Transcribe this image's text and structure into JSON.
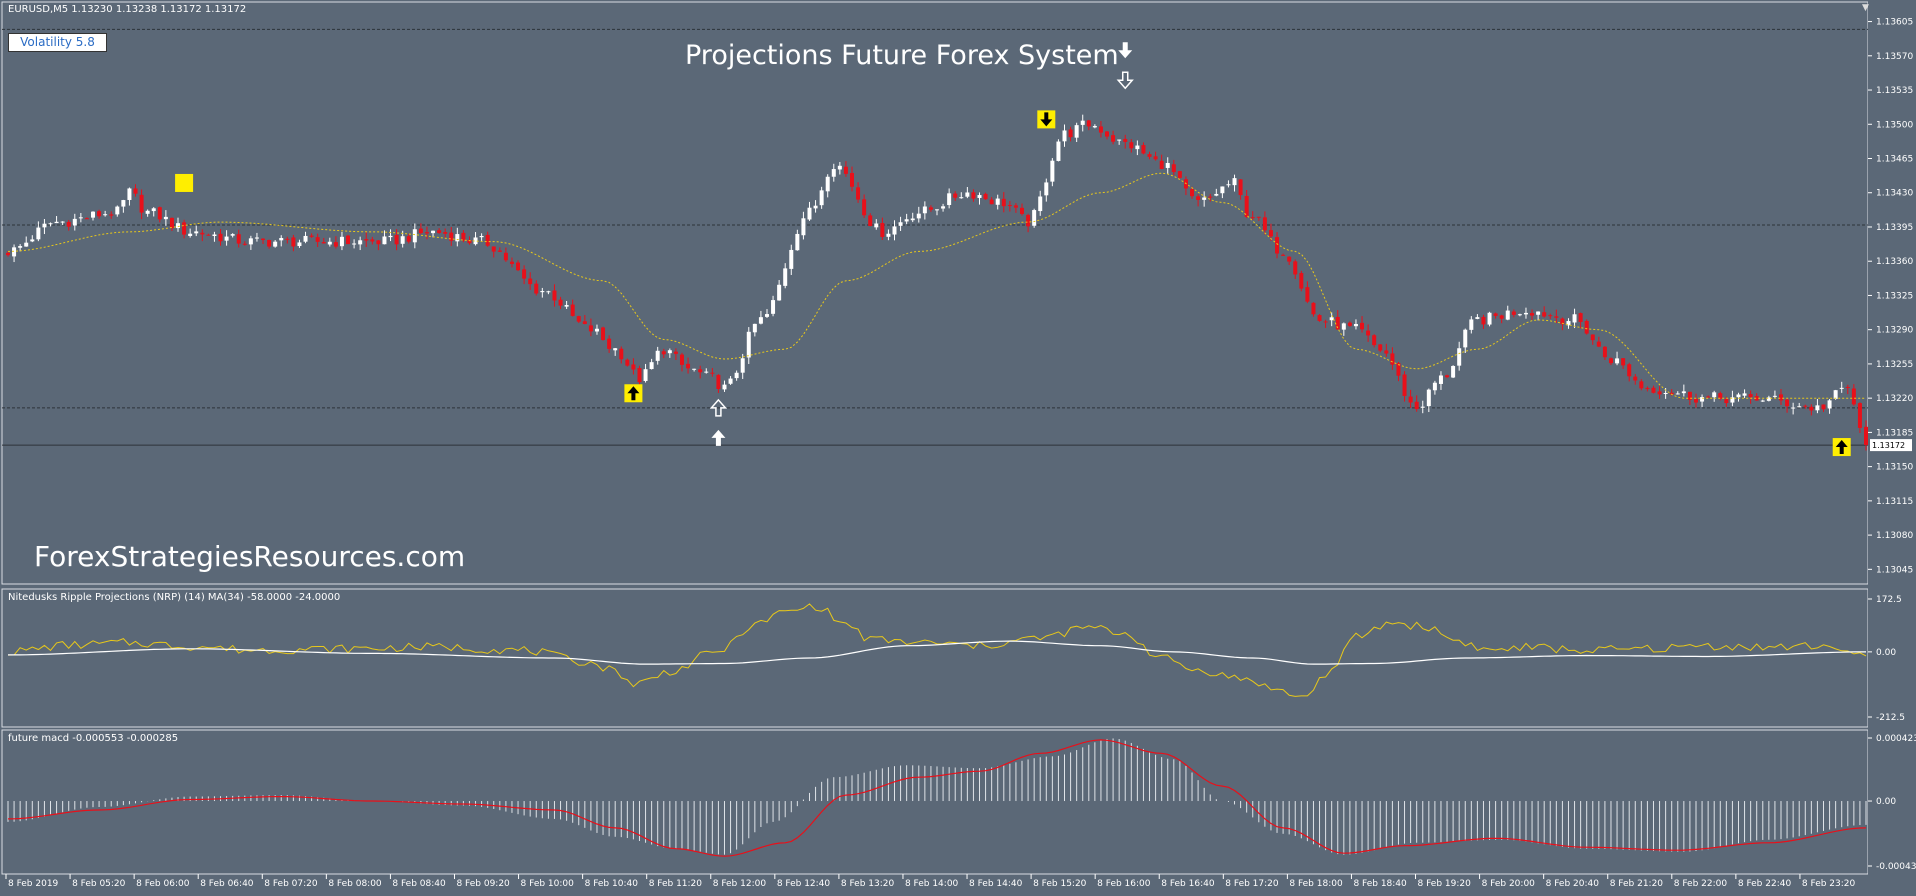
{
  "chart_header": {
    "symbol_line": "EURUSD,M5  1.13230 1.13238 1.13172 1.13172",
    "volatility_label": "Volatility 5.8",
    "title": "Projections Future Forex System",
    "watermark": "ForexStrategiesResources.com"
  },
  "nrp_panel": {
    "label": "Nitedusks Ripple Projections (NRP) (14) MA(34) -58.0000 -24.0000",
    "scale": [
      "172.5",
      "0.00",
      "-212.5"
    ]
  },
  "macd_panel": {
    "label": "future macd -0.000553 -0.000285",
    "scale": [
      "0.000423",
      "0.00",
      "-0.000436"
    ]
  },
  "price_axis": [
    "1.13605",
    "1.13570",
    "1.13535",
    "1.13500",
    "1.13465",
    "1.13430",
    "1.13395",
    "1.13360",
    "1.13325",
    "1.13290",
    "1.13255",
    "1.13220",
    "1.13185",
    "1.13150",
    "1.13115",
    "1.13080",
    "1.13045"
  ],
  "current_price": "1.13172",
  "time_axis": [
    "8 Feb 2019",
    "8 Feb 05:20",
    "8 Feb 06:00",
    "8 Feb 06:40",
    "8 Feb 07:20",
    "8 Feb 08:00",
    "8 Feb 08:40",
    "8 Feb 09:20",
    "8 Feb 10:00",
    "8 Feb 10:40",
    "8 Feb 11:20",
    "8 Feb 12:00",
    "8 Feb 12:40",
    "8 Feb 13:20",
    "8 Feb 14:00",
    "8 Feb 14:40",
    "8 Feb 15:20",
    "8 Feb 16:00",
    "8 Feb 16:40",
    "8 Feb 17:20",
    "8 Feb 18:00",
    "8 Feb 18:40",
    "8 Feb 19:20",
    "8 Feb 20:00",
    "8 Feb 20:40",
    "8 Feb 21:20",
    "8 Feb 22:00",
    "8 Feb 22:40",
    "8 Feb 23:20"
  ],
  "colors": {
    "background": "#5b6877",
    "bull_candle": "#ffffff",
    "bear_candle": "#e8101a",
    "ma_line": "#e8c81a",
    "signal_box": "#ffee00",
    "nrp_fast": "#e8c81a",
    "nrp_slow": "#ffffff",
    "macd_signal": "#e8101a",
    "macd_hist": "#dfe3e8"
  },
  "chart_data": {
    "type": "candlestick",
    "symbol": "EURUSD",
    "timeframe": "M5",
    "ylim": [
      1.1303,
      1.13625
    ],
    "close_anchors": [
      [
        0,
        1.1337
      ],
      [
        8,
        1.134
      ],
      [
        18,
        1.1341
      ],
      [
        20,
        1.1343
      ],
      [
        23,
        1.1341
      ],
      [
        30,
        1.1339
      ],
      [
        40,
        1.1338
      ],
      [
        55,
        1.1338
      ],
      [
        62,
        1.1338
      ],
      [
        70,
        1.1339
      ],
      [
        78,
        1.1338
      ],
      [
        88,
        1.1333
      ],
      [
        96,
        1.1329
      ],
      [
        100,
        1.1327
      ],
      [
        104,
        1.1324
      ],
      [
        108,
        1.1327
      ],
      [
        112,
        1.1325
      ],
      [
        116,
        1.1324
      ],
      [
        118,
        1.1323
      ],
      [
        124,
        1.133
      ],
      [
        132,
        1.1341
      ],
      [
        136,
        1.1346
      ],
      [
        144,
        1.1339
      ],
      [
        150,
        1.1341
      ],
      [
        158,
        1.1343
      ],
      [
        164,
        1.1342
      ],
      [
        168,
        1.134
      ],
      [
        174,
        1.1349
      ],
      [
        178,
        1.135
      ],
      [
        184,
        1.1348
      ],
      [
        190,
        1.1346
      ],
      [
        196,
        1.1342
      ],
      [
        202,
        1.1344
      ],
      [
        204,
        1.1341
      ],
      [
        210,
        1.1337
      ],
      [
        216,
        1.133
      ],
      [
        222,
        1.1329
      ],
      [
        226,
        1.1327
      ],
      [
        232,
        1.1321
      ],
      [
        236,
        1.1324
      ],
      [
        242,
        1.133
      ],
      [
        250,
        1.1331
      ],
      [
        258,
        1.133
      ],
      [
        264,
        1.1326
      ],
      [
        270,
        1.1323
      ],
      [
        280,
        1.1322
      ],
      [
        288,
        1.1322
      ],
      [
        298,
        1.1321
      ],
      [
        303,
        1.1323
      ],
      [
        306,
        1.1317
      ]
    ],
    "ma_anchors": [
      [
        0,
        1.1337
      ],
      [
        20,
        1.1339
      ],
      [
        35,
        1.134
      ],
      [
        60,
        1.1339
      ],
      [
        80,
        1.1338
      ],
      [
        98,
        1.1334
      ],
      [
        108,
        1.1328
      ],
      [
        118,
        1.1326
      ],
      [
        128,
        1.1327
      ],
      [
        138,
        1.1334
      ],
      [
        150,
        1.1337
      ],
      [
        168,
        1.134
      ],
      [
        180,
        1.1343
      ],
      [
        190,
        1.1345
      ],
      [
        200,
        1.1342
      ],
      [
        212,
        1.1337
      ],
      [
        222,
        1.1327
      ],
      [
        232,
        1.1325
      ],
      [
        242,
        1.1327
      ],
      [
        252,
        1.133
      ],
      [
        262,
        1.1329
      ],
      [
        276,
        1.1322
      ],
      [
        290,
        1.1322
      ],
      [
        306,
        1.1322
      ]
    ],
    "nrp_fast_anchors": [
      [
        0,
        0
      ],
      [
        10,
        22
      ],
      [
        20,
        30
      ],
      [
        30,
        18
      ],
      [
        40,
        6
      ],
      [
        55,
        10
      ],
      [
        70,
        16
      ],
      [
        85,
        5
      ],
      [
        95,
        -32
      ],
      [
        100,
        -60
      ],
      [
        103,
        -105
      ],
      [
        110,
        -60
      ],
      [
        115,
        -10
      ],
      [
        118,
        10
      ],
      [
        122,
        80
      ],
      [
        128,
        130
      ],
      [
        133,
        150
      ],
      [
        138,
        90
      ],
      [
        142,
        40
      ],
      [
        150,
        30
      ],
      [
        160,
        20
      ],
      [
        170,
        45
      ],
      [
        178,
        80
      ],
      [
        184,
        60
      ],
      [
        190,
        -20
      ],
      [
        196,
        -60
      ],
      [
        204,
        -90
      ],
      [
        210,
        -130
      ],
      [
        213,
        -150
      ],
      [
        218,
        -60
      ],
      [
        222,
        50
      ],
      [
        228,
        95
      ],
      [
        234,
        80
      ],
      [
        238,
        40
      ],
      [
        244,
        5
      ],
      [
        250,
        15
      ],
      [
        260,
        5
      ],
      [
        270,
        10
      ],
      [
        280,
        20
      ],
      [
        290,
        15
      ],
      [
        300,
        20
      ],
      [
        306,
        -20
      ]
    ],
    "nrp_slow_anchors": [
      [
        0,
        -10
      ],
      [
        30,
        10
      ],
      [
        60,
        -5
      ],
      [
        90,
        -20
      ],
      [
        105,
        -40
      ],
      [
        118,
        -38
      ],
      [
        132,
        -20
      ],
      [
        148,
        20
      ],
      [
        165,
        35
      ],
      [
        180,
        20
      ],
      [
        192,
        0
      ],
      [
        205,
        -20
      ],
      [
        215,
        -40
      ],
      [
        225,
        -38
      ],
      [
        240,
        -20
      ],
      [
        260,
        -12
      ],
      [
        280,
        -15
      ],
      [
        306,
        0
      ]
    ],
    "macd_signal_anchors": [
      [
        0,
        -0.00012
      ],
      [
        15,
        -6e-05
      ],
      [
        30,
        1e-05
      ],
      [
        45,
        3e-05
      ],
      [
        60,
        0.0
      ],
      [
        75,
        -2e-05
      ],
      [
        90,
        -6e-05
      ],
      [
        100,
        -0.00018
      ],
      [
        110,
        -0.00032
      ],
      [
        118,
        -0.00037
      ],
      [
        128,
        -0.00028
      ],
      [
        138,
        4e-05
      ],
      [
        150,
        0.00016
      ],
      [
        160,
        0.0002
      ],
      [
        170,
        0.00032
      ],
      [
        180,
        0.00041
      ],
      [
        190,
        0.00032
      ],
      [
        200,
        0.0001
      ],
      [
        210,
        -0.00018
      ],
      [
        220,
        -0.00035
      ],
      [
        230,
        -0.0003
      ],
      [
        245,
        -0.00025
      ],
      [
        260,
        -0.00031
      ],
      [
        275,
        -0.00033
      ],
      [
        290,
        -0.00028
      ],
      [
        306,
        -0.00018
      ]
    ],
    "macd_hist_anchors": [
      [
        0,
        -0.00014
      ],
      [
        15,
        -4e-05
      ],
      [
        30,
        3e-05
      ],
      [
        45,
        4e-05
      ],
      [
        60,
        0.0
      ],
      [
        75,
        -3e-05
      ],
      [
        90,
        -0.00012
      ],
      [
        100,
        -0.00024
      ],
      [
        110,
        -0.00032
      ],
      [
        118,
        -0.00036
      ],
      [
        126,
        -0.00014
      ],
      [
        136,
        0.00016
      ],
      [
        148,
        0.00024
      ],
      [
        160,
        0.00022
      ],
      [
        172,
        0.0003
      ],
      [
        182,
        0.00042
      ],
      [
        192,
        0.00028
      ],
      [
        200,
        0.0
      ],
      [
        210,
        -0.00022
      ],
      [
        220,
        -0.00036
      ],
      [
        232,
        -0.00028
      ],
      [
        246,
        -0.00026
      ],
      [
        260,
        -0.00032
      ],
      [
        276,
        -0.00034
      ],
      [
        290,
        -0.00026
      ],
      [
        306,
        -0.00016
      ]
    ],
    "signals": [
      {
        "type": "buy",
        "index": 103,
        "price": 1.13225,
        "style": "yellow-arrow"
      },
      {
        "type": "buy",
        "index": 117,
        "price": 1.1321,
        "style": "white-arrow-pair"
      },
      {
        "type": "sell",
        "index": 171,
        "price": 1.13505,
        "style": "yellow-arrow"
      },
      {
        "type": "sell",
        "index": 184,
        "price": 1.13545,
        "style": "white-arrow-pair"
      },
      {
        "type": "buy",
        "index": 302,
        "price": 1.1317,
        "style": "yellow-arrow"
      },
      {
        "type": "neutral",
        "index": 29,
        "price": 1.1344,
        "style": "yellow-square"
      }
    ],
    "levels": [
      1.13597,
      1.13397,
      1.1321,
      1.13172
    ]
  }
}
